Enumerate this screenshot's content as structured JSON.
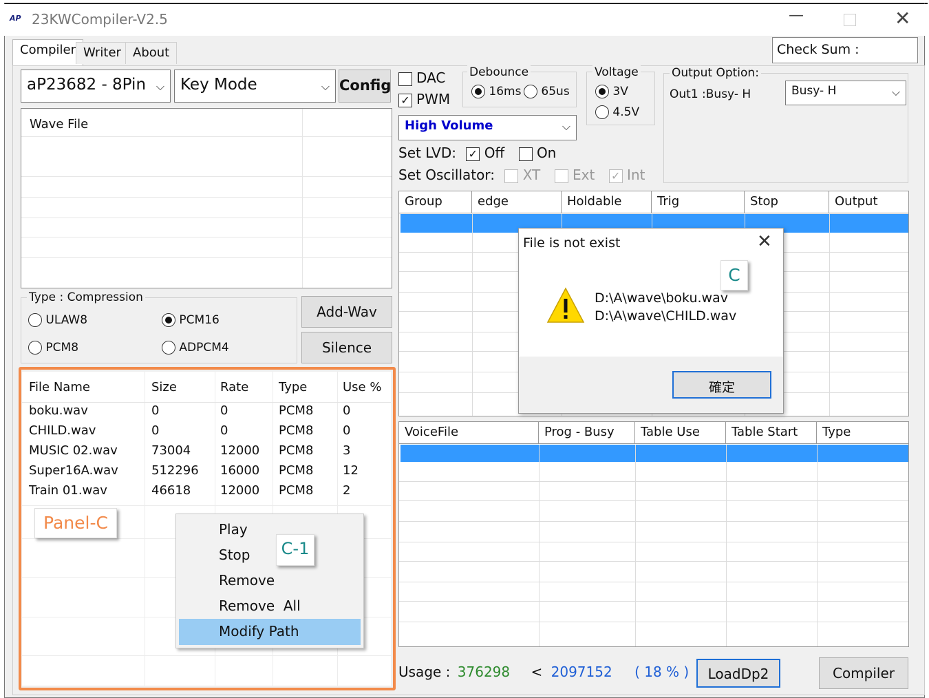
{
  "window": {
    "title": "23KWCompiler-V2.5",
    "logo_text": "AP"
  },
  "tabs": [
    "Compiler",
    "Writer",
    "About"
  ],
  "checksum": {
    "label": "Check Sum :"
  },
  "chip_select": {
    "value": "aP23682 - 8Pin"
  },
  "mode_select": {
    "value": "Key Mode"
  },
  "config_button": "Config",
  "dac": {
    "label": "DAC",
    "checked": false
  },
  "pwm": {
    "label": "PWM",
    "checked": true
  },
  "debounce": {
    "label": "Debounce",
    "options": [
      "16ms",
      "65us"
    ],
    "selected": "16ms"
  },
  "voltage": {
    "label": "Voltage",
    "options": [
      "3V",
      "4.5V"
    ],
    "selected": "3V"
  },
  "output_option": {
    "label": "Output Option:",
    "out_text": "Out1 :Busy- H",
    "select_value": "Busy- H"
  },
  "volume_select": {
    "value": "High Volume",
    "color": "#0000cc"
  },
  "lvd": {
    "label": "Set LVD:",
    "off_label": "Off",
    "on_label": "On",
    "off_checked": true,
    "on_checked": false
  },
  "oscillator": {
    "label": "Set Oscillator:",
    "xt": "XT",
    "ext": "Ext",
    "int": "Int"
  },
  "wave_file_list": {
    "header": "Wave File"
  },
  "compression": {
    "label": "Type : Compression",
    "options": [
      "ULAW8",
      "PCM16",
      "PCM8",
      "ADPCM4"
    ],
    "selected": "PCM16"
  },
  "add_wav_button": "Add-Wav",
  "silence_button": "Silence",
  "file_table": {
    "columns": [
      "File Name",
      "Size",
      "Rate",
      "Type",
      "Use %"
    ],
    "rows": [
      [
        "boku.wav",
        "0",
        "0",
        "PCM8",
        "0"
      ],
      [
        "CHILD.wav",
        "0",
        "0",
        "PCM8",
        "0"
      ],
      [
        "MUSIC 02.wav",
        "73004",
        "12000",
        "PCM8",
        "3"
      ],
      [
        "Super16A.wav",
        "512296",
        "16000",
        "PCM8",
        "12"
      ],
      [
        "Train 01.wav",
        "46618",
        "12000",
        "PCM8",
        "2"
      ]
    ]
  },
  "group_table": {
    "columns": [
      "Group",
      "edge",
      "Holdable",
      "Trig",
      "Stop",
      "Output"
    ]
  },
  "voice_table": {
    "columns": [
      "VoiceFile",
      "Prog - Busy",
      "Table Use",
      "Table Start",
      "Type"
    ]
  },
  "context_menu": {
    "items": [
      "Play",
      "Stop",
      "Remove",
      "Remove  All",
      "Modify Path"
    ],
    "highlighted": "Modify Path"
  },
  "dialog": {
    "title": "File is not exist",
    "lines": [
      "D:\\A\\wave\\boku.wav",
      "D:\\A\\wave\\CHILD.wav"
    ],
    "ok_button": "確定"
  },
  "callouts": {
    "dialog": "C",
    "menu": "C-1",
    "panel": "Panel-C"
  },
  "usage": {
    "label": "Usage :",
    "used": "376298",
    "lt": "<",
    "total": "2097152",
    "percent": "( 18 % )",
    "used_color": "#2e8b2e",
    "total_color": "#1f5fd6"
  },
  "loaddp2_button": "LoadDp2",
  "compiler_button": "Compiler",
  "colors": {
    "selection": "#3399ff",
    "menu_highlight": "#99ccf3",
    "callout_orange": "#f28a4a",
    "callout_teal": "#1a8a8a"
  }
}
